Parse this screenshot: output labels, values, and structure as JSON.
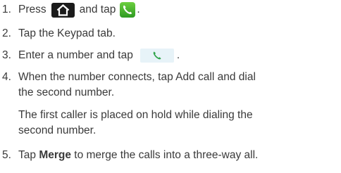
{
  "steps": [
    {
      "num": "1.",
      "text_a": "Press",
      "text_b": "and tap",
      "text_c": "."
    },
    {
      "num": "2.",
      "text": "Tap the Keypad tab."
    },
    {
      "num": "3.",
      "text_a": "Enter a number and tap",
      "text_b": "."
    },
    {
      "num": "4.",
      "line1": "When the number connects, tap Add call and dial",
      "line2": "the second number.",
      "note1": "The first caller is placed on hold while dialing the",
      "note2": "second number."
    },
    {
      "num": "5.",
      "text_a": "Tap",
      "bold": "Merge",
      "text_b": "to merge the calls into a three-way all."
    }
  ],
  "icons": {
    "home": "home-icon",
    "phone_app": "phone-app-icon",
    "call": "call-button-icon"
  },
  "colors": {
    "text": "#3a3a3a",
    "home_icon_bg": "#1b1b1b",
    "phone_app_green": "#3fae2a",
    "call_button_bg": "#e7f3f8",
    "call_handset": "#2fa44a"
  }
}
